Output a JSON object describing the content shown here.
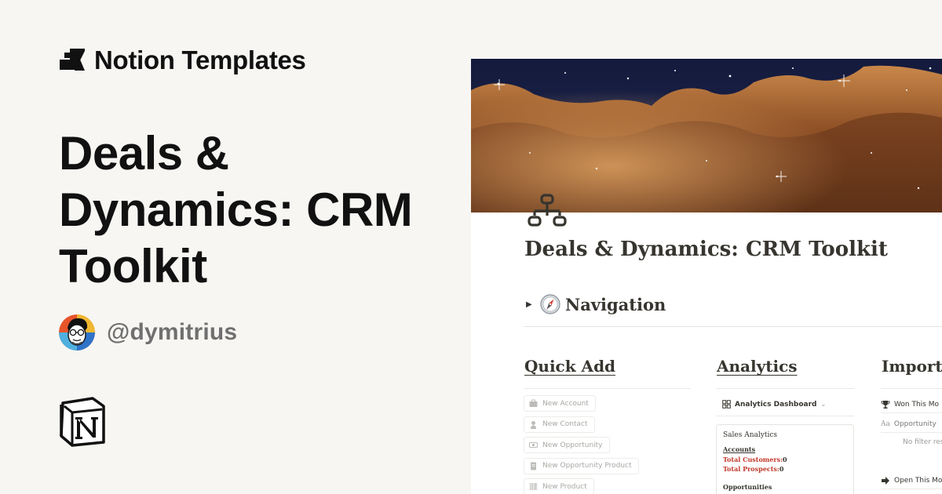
{
  "brand": {
    "name": "Notion Templates"
  },
  "headline": {
    "lines": [
      "Deals &",
      "Dynamics: CRM",
      "Toolkit"
    ]
  },
  "author": {
    "handle": "@dymitrius"
  },
  "preview": {
    "page_title": "Deals & Dynamics: CRM Toolkit",
    "navigation_label": "Navigation",
    "columns": {
      "quick_add": {
        "heading": "Quick Add",
        "buttons": [
          "New Account",
          "New Contact",
          "New Opportunity",
          "New Opportunity Product",
          "New Product"
        ]
      },
      "analytics": {
        "heading": "Analytics",
        "view_name": "Analytics Dashboard",
        "card": {
          "title": "Sales Analytics",
          "section": "Accounts",
          "total_customers_label": "Total Customers:",
          "total_customers_value": "0",
          "total_prospects_label": "Total Prospects:",
          "total_prospects_value": "0",
          "section2": "Opportunities"
        }
      },
      "important": {
        "heading": "Importa",
        "rows": [
          "Won This Mo",
          "Opportunity",
          "No filter res",
          "Open This Mo"
        ]
      }
    }
  },
  "colors": {
    "background": "#f7f6f3",
    "text": "#111111",
    "handle": "#707070",
    "page_text": "#37352f",
    "stat_label": "#c0392b",
    "muted": "#a9a8a4"
  },
  "icons": {
    "brand": "notion-templates-logo-icon",
    "avatar": "cartoon-avatar-icon",
    "notion": "notion-logo-icon",
    "page": "org-chart-icon",
    "navigation": "compass-icon"
  }
}
